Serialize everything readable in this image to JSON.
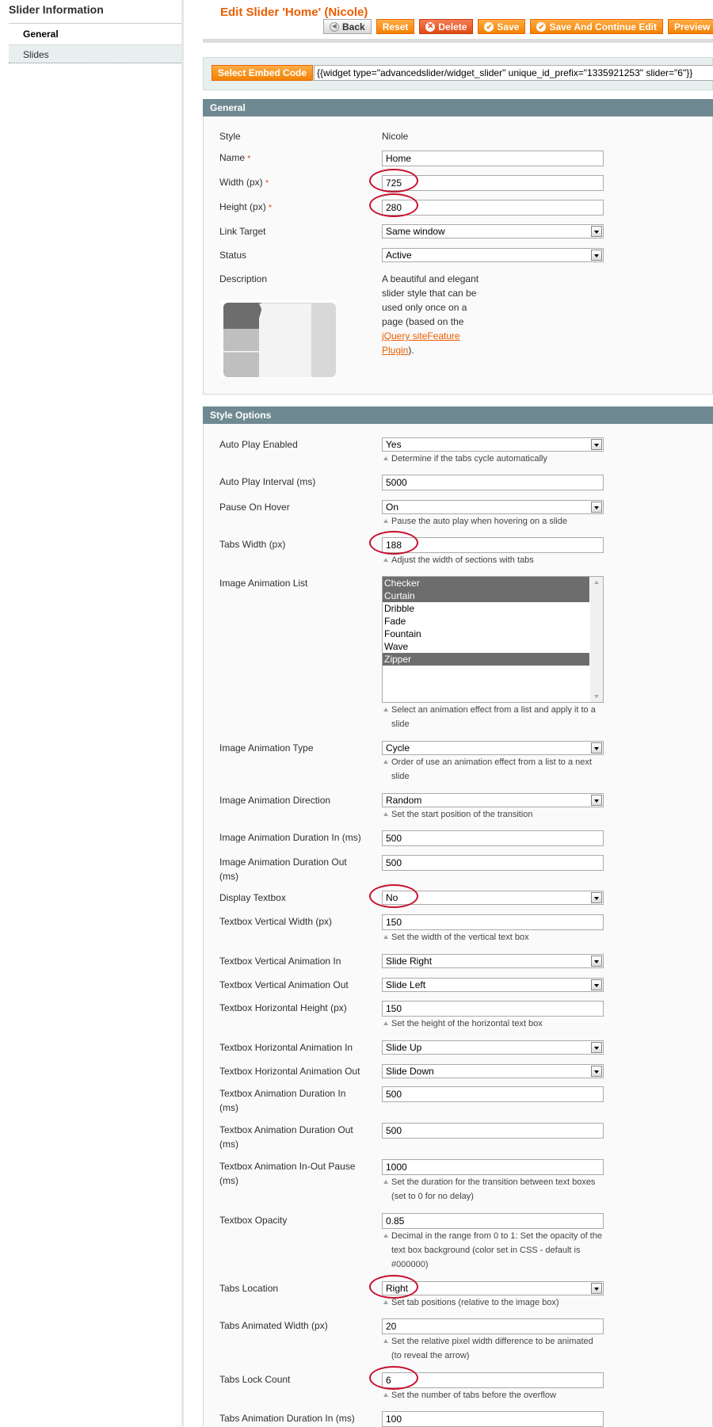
{
  "sidebar": {
    "title": "Slider Information",
    "items": [
      {
        "label": "General",
        "active": true
      },
      {
        "label": "Slides",
        "active": false
      }
    ]
  },
  "header": {
    "title": "Edit Slider 'Home' (Nicole)",
    "buttons": {
      "back": "Back",
      "reset": "Reset",
      "delete": "Delete",
      "save": "Save",
      "save_continue": "Save And Continue Edit",
      "preview": "Preview"
    }
  },
  "embed": {
    "button": "Select Embed Code",
    "code": "{{widget type=\"advancedslider/widget_slider\" unique_id_prefix=\"1335921253\" slider=\"6\"}}"
  },
  "general": {
    "heading": "General",
    "style_label": "Style",
    "style_value": "Nicole",
    "name_label": "Name",
    "name_value": "Home",
    "width_label": "Width (px)",
    "width_value": "725",
    "height_label": "Height (px)",
    "height_value": "280",
    "link_target_label": "Link Target",
    "link_target_value": "Same window",
    "status_label": "Status",
    "status_value": "Active",
    "description_label": "Description",
    "description_text": "A beautiful and elegant slider style that can be used only once on a page (based on the ",
    "description_link": "jQuery siteFeature Plugin",
    "description_end": ").",
    "required_mark": "*"
  },
  "style_options": {
    "heading": "Style Options",
    "fields": {
      "auto_play_enabled": {
        "label": "Auto Play Enabled",
        "value": "Yes",
        "note": "Determine if the tabs cycle automatically"
      },
      "auto_play_interval": {
        "label": "Auto Play Interval (ms)",
        "value": "5000"
      },
      "pause_on_hover": {
        "label": "Pause On Hover",
        "value": "On",
        "note": "Pause the auto play when hovering on a slide"
      },
      "tabs_width": {
        "label": "Tabs Width (px)",
        "value": "188",
        "note": "Adjust the width of sections with tabs"
      },
      "image_animation_list": {
        "label": "Image Animation List",
        "options": [
          {
            "label": "Checker",
            "selected": true
          },
          {
            "label": "Curtain",
            "selected": true
          },
          {
            "label": "Dribble",
            "selected": false
          },
          {
            "label": "Fade",
            "selected": false
          },
          {
            "label": "Fountain",
            "selected": false
          },
          {
            "label": "Wave",
            "selected": false
          },
          {
            "label": "Zipper",
            "selected": true
          }
        ],
        "note": "Select an animation effect from a list and apply it to a slide"
      },
      "image_animation_type": {
        "label": "Image Animation Type",
        "value": "Cycle",
        "note": "Order of use an animation effect from a list to a next slide"
      },
      "image_animation_direction": {
        "label": "Image Animation Direction",
        "value": "Random",
        "note": "Set the start position of the transition"
      },
      "image_animation_duration_in": {
        "label": "Image Animation Duration In (ms)",
        "value": "500"
      },
      "image_animation_duration_out": {
        "label": "Image Animation Duration Out (ms)",
        "value": "500"
      },
      "display_textbox": {
        "label": "Display Textbox",
        "value": "No"
      },
      "textbox_vertical_width": {
        "label": "Textbox Vertical Width (px)",
        "value": "150",
        "note": "Set the width of the vertical text box"
      },
      "textbox_vertical_animation_in": {
        "label": "Textbox Vertical Animation In",
        "value": "Slide Right"
      },
      "textbox_vertical_animation_out": {
        "label": "Textbox Vertical Animation Out",
        "value": "Slide Left"
      },
      "textbox_horizontal_height": {
        "label": "Textbox Horizontal Height (px)",
        "value": "150",
        "note": "Set the height of the horizontal text box"
      },
      "textbox_horizontal_animation_in": {
        "label": "Textbox Horizontal Animation In",
        "value": "Slide Up"
      },
      "textbox_horizontal_animation_out": {
        "label": "Textbox Horizontal Animation Out",
        "value": "Slide Down"
      },
      "textbox_animation_duration_in": {
        "label": "Textbox Animation Duration In (ms)",
        "value": "500"
      },
      "textbox_animation_duration_out": {
        "label": "Textbox Animation Duration Out (ms)",
        "value": "500"
      },
      "textbox_animation_pause": {
        "label": "Textbox Animation In-Out Pause (ms)",
        "value": "1000",
        "note": "Set the duration for the transition between text boxes (set to 0 for no delay)"
      },
      "textbox_opacity": {
        "label": "Textbox Opacity",
        "value": "0.85",
        "note": "Decimal in the range from 0 to 1: Set the opacity of the text box background (color set in CSS - default is #000000)"
      },
      "tabs_location": {
        "label": "Tabs Location",
        "value": "Right",
        "note": "Set tab positions (relative to the image box)"
      },
      "tabs_animated_width": {
        "label": "Tabs Animated Width (px)",
        "value": "20",
        "note": "Set the relative pixel width difference to be animated (to reveal the arrow)"
      },
      "tabs_lock_count": {
        "label": "Tabs Lock Count",
        "value": "6",
        "note": "Set the number of tabs before the overflow"
      },
      "tabs_animation_duration_in": {
        "label": "Tabs Animation Duration In (ms)",
        "value": "100"
      }
    }
  },
  "colors": {
    "accent": "#eb5e00",
    "section_header": "#6f8992",
    "annotation_circle": "#c8102e"
  }
}
